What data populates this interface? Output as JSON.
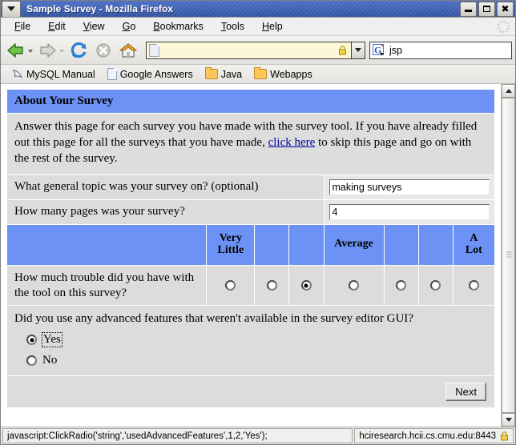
{
  "window": {
    "title": "Sample Survey - Mozilla Firefox",
    "menu_icon": "chevron-down-icon",
    "minimize_label": "_",
    "maximize_label": "□",
    "close_label": "✖"
  },
  "menubar": {
    "items": [
      {
        "pre": "",
        "key": "F",
        "post": "ile"
      },
      {
        "pre": "",
        "key": "E",
        "post": "dit"
      },
      {
        "pre": "",
        "key": "V",
        "post": "iew"
      },
      {
        "pre": "",
        "key": "G",
        "post": "o"
      },
      {
        "pre": "",
        "key": "B",
        "post": "ookmarks"
      },
      {
        "pre": "",
        "key": "T",
        "post": "ools"
      },
      {
        "pre": "",
        "key": "H",
        "post": "elp"
      }
    ]
  },
  "toolbar": {
    "back": "back-arrow-icon",
    "forward": "forward-arrow-icon",
    "reload": "reload-icon",
    "stop": "stop-icon",
    "home": "home-icon",
    "url_value": "",
    "url_placeholder": "",
    "lock": "lock-icon",
    "dropdown": "chevron-down-icon",
    "search_value": "jsp",
    "search_placeholder": "",
    "search_engine_icon": "google-g-icon"
  },
  "bookmarks": [
    {
      "label": "MySQL Manual",
      "icon": "dolphin-icon"
    },
    {
      "label": "Google Answers",
      "icon": "document-icon"
    },
    {
      "label": "Java",
      "icon": "folder-icon"
    },
    {
      "label": "Webapps",
      "icon": "folder-icon"
    }
  ],
  "page": {
    "heading": "About Your Survey",
    "intro_part1": "Answer this page for each survey you have made with the survey tool. If you have already filled out this page for all the surveys that you have made, ",
    "intro_link": "click here",
    "intro_part2": " to skip this page and go on with the rest of the survey.",
    "questions": [
      {
        "label": "What general topic was your survey on? (optional)",
        "value": "making surveys"
      },
      {
        "label": "How many pages was your survey?",
        "value": "4"
      }
    ],
    "scale": {
      "headers": [
        "",
        "Very Little",
        "",
        "",
        "Average",
        "",
        "",
        "A Lot"
      ],
      "question": "How much trouble did you have with the tool on this survey?",
      "option_count": 7,
      "selected_index": 2
    },
    "yesno": {
      "question": "Did you use any advanced features that weren't available in the survey editor GUI?",
      "options": [
        {
          "label": "Yes",
          "selected": true,
          "focused": true
        },
        {
          "label": "No",
          "selected": false,
          "focused": false
        }
      ]
    },
    "next_button": "Next"
  },
  "scrollbar": {
    "up_icon": "triangle-up-icon",
    "down_icon": "triangle-down-icon"
  },
  "statusbar": {
    "message": "javascript:ClickRadio('string','usedAdvancedFeatures',1,2,'Yes');",
    "security_host": "hciresearch.hcii.cs.cmu.edu:8443",
    "security_icon": "lock-icon"
  },
  "colors": {
    "titlebar_blue": "#3f62b5",
    "table_header_blue": "#6d92f5",
    "row_gray": "#dcdcdc",
    "link_blue": "#00009e"
  }
}
